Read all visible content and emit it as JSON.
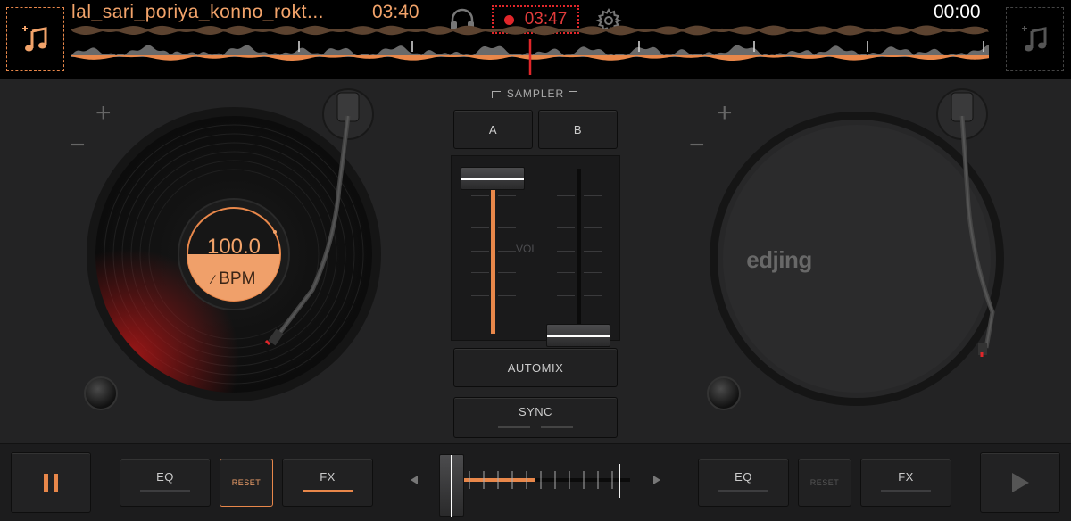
{
  "top_bar": {
    "track_title": "lal_sari_poriya_konno_rokt...",
    "track_time": "03:40",
    "record_time": "03:47",
    "right_deck_time": "00:00"
  },
  "deck_left": {
    "bpm_value": "100.0",
    "bpm_label": "BPM",
    "pitch_plus": "+",
    "pitch_minus": "−"
  },
  "deck_right": {
    "logo": "edjing",
    "pitch_plus": "+",
    "pitch_minus": "−"
  },
  "mixer": {
    "sampler_label": "SAMPLER",
    "sampler_a": "A",
    "sampler_b": "B",
    "vol_label": "VOL",
    "left_fader_level": 0.95,
    "right_fader_level": 0.0,
    "automix_label": "AUTOMIX",
    "sync_label": "SYNC"
  },
  "bottom_bar": {
    "left": {
      "eq_label": "EQ",
      "reset_label": "RESET",
      "fx_label": "FX",
      "fx_active": true
    },
    "right": {
      "eq_label": "EQ",
      "reset_label": "RESET",
      "fx_label": "FX",
      "fx_active": false
    },
    "crossfader_position": 0.0
  },
  "icons": {
    "load_track_left": "music-note-plus-icon",
    "load_track_right": "music-note-plus-icon",
    "headphone": "headphone-icon",
    "record": "record-dot-icon",
    "settings": "gear-icon",
    "pause": "pause-icon",
    "play": "play-icon"
  },
  "colors": {
    "accent": "#e8874a",
    "record": "#e0262a",
    "background": "#232324"
  }
}
